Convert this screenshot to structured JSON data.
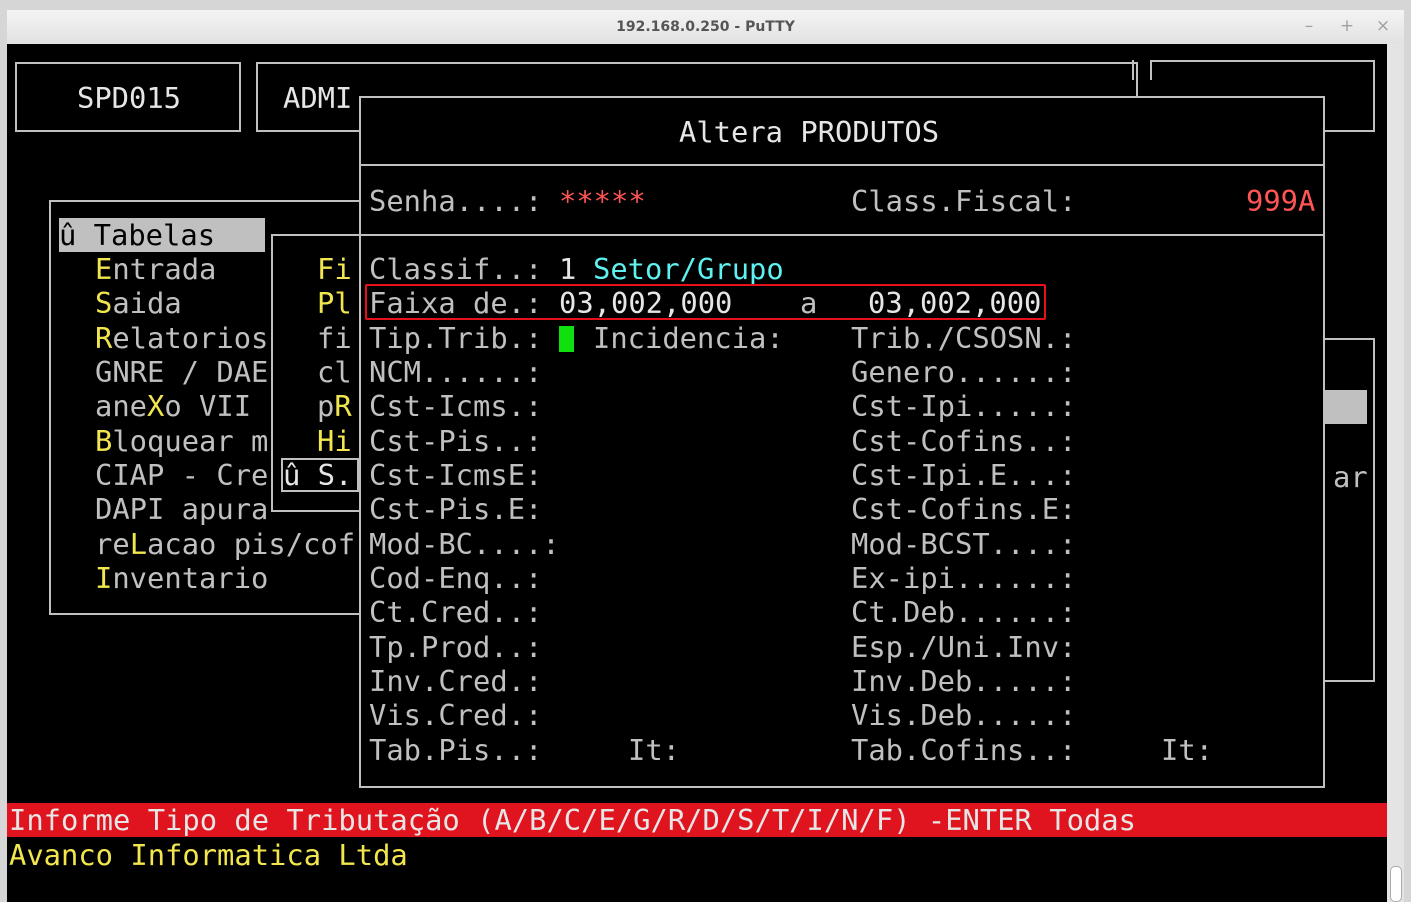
{
  "window": {
    "title": "192.168.0.250 - PuTTY",
    "controls": {
      "minimize": "–",
      "maximize": "+",
      "close": "×"
    }
  },
  "header": {
    "program_code": "SPD015",
    "user": "ADMI"
  },
  "menu": {
    "selected": "û Tabelas",
    "items": [
      {
        "hotkey": "E",
        "rest": "ntrada"
      },
      {
        "hotkey": "S",
        "rest": "aida"
      },
      {
        "hotkey": "R",
        "rest": "elatorios"
      },
      {
        "pre": "GNRE / DAE"
      },
      {
        "pre": "ane",
        "hotkey": "X",
        "rest": "o VII"
      },
      {
        "hotkey": "B",
        "rest": "loquear m"
      },
      {
        "pre": "CIAP - Cre"
      },
      {
        "pre": "DAPI apura"
      },
      {
        "pre": "re",
        "hotkey": "L",
        "rest": "acao pis/cof"
      },
      {
        "hotkey": "I",
        "rest": "nventario"
      }
    ]
  },
  "submenu": {
    "items": [
      {
        "hotkey": "Fi",
        "rest": ""
      },
      {
        "hotkey": "Pl",
        "rest": ""
      },
      {
        "hotkey": "",
        "rest": "fi"
      },
      {
        "hotkey": "",
        "rest": "cl"
      },
      {
        "pre": "p",
        "hotkey": "R",
        "rest": ""
      },
      {
        "hotkey": "Hi",
        "rest": ""
      }
    ],
    "selected": "û S."
  },
  "right_panel": {
    "fragment": "ar"
  },
  "dialog": {
    "title": "Altera PRODUTOS",
    "password_label": "Senha....:",
    "password_value": "*****",
    "class_fiscal_label": "Class.Fiscal:",
    "class_fiscal_value": "999A",
    "classif_label": "Classif..:",
    "classif_value": "1",
    "classif_desc": "Setor/Grupo",
    "faixa_label": "Faixa de.:",
    "faixa_from": "03,002,000",
    "faixa_sep": "a",
    "faixa_to": "03,002,000",
    "left_fields": [
      "Tip.Trib.:",
      "NCM......:",
      "Cst-Icms.:",
      "Cst-Pis..:",
      "Cst-IcmsE:",
      "Cst-Pis.E:",
      "Mod-BC....:",
      "Cod-Enq..:",
      "Ct.Cred..:",
      "Tp.Prod..:",
      "Inv.Cred.:",
      "Vis.Cred.:",
      "Tab.Pis..:"
    ],
    "incidencia_label": "Incidencia:",
    "it_label": "It:",
    "right_fields": [
      "Trib./CSOSN.:",
      "Genero......:",
      "Cst-Ipi.....:",
      "Cst-Cofins..:",
      "Cst-Ipi.E...:",
      "Cst-Cofins.E:",
      "Mod-BCST....:",
      "Ex-ipi......:",
      "Ct.Deb......:",
      "Esp./Uni.Inv:",
      "Inv.Deb.....:",
      "Vis.Deb.....:",
      "Tab.Cofins..:"
    ]
  },
  "status": {
    "message": "Informe Tipo de Tributação (A/B/C/E/G/R/D/S/T/I/N/F) -ENTER Todas",
    "company": "Avanco Informatica Ltda"
  },
  "colors": {
    "terminal_bg": "#000000",
    "text": "#c0c0c0",
    "highlight_yellow": "#f2e64f",
    "error_red": "#ff5555",
    "cyan": "#5ff0f0",
    "status_bar": "#e0141e",
    "cursor": "#10e010",
    "annotation_box": "#e8101a"
  }
}
